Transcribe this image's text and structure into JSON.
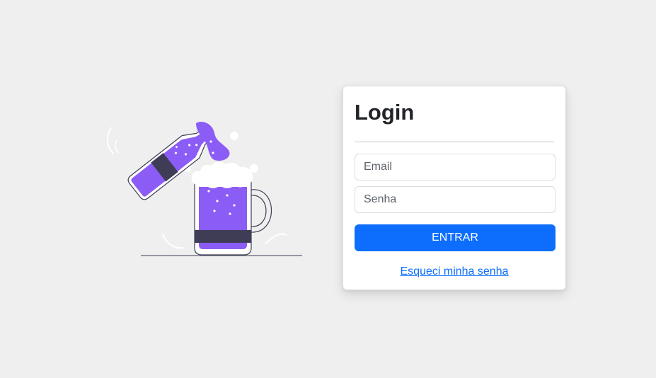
{
  "login": {
    "title": "Login",
    "email_placeholder": "Email",
    "senha_placeholder": "Senha",
    "submit_label": "ENTRAR",
    "forgot_label": "Esqueci minha senha"
  },
  "illustration": {
    "icon": "beer-pouring-icon"
  },
  "colors": {
    "background": "#efefef",
    "primary": "#0d6efd",
    "accent_purple": "#8c5cf6",
    "dark_band": "#3f3d56"
  }
}
